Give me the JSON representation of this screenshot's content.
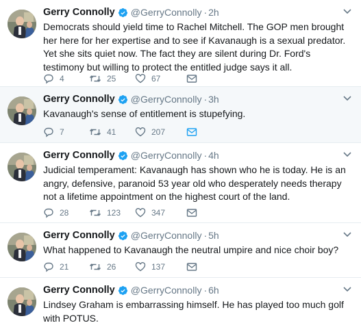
{
  "colors": {
    "accent": "#1da1f2",
    "muted": "#657786",
    "text": "#14171a",
    "border": "#e6ecf0",
    "hover_bg": "#f5f8fa"
  },
  "icons": [
    "avatar",
    "verified-badge-icon",
    "caret-down-icon",
    "reply-icon",
    "retweet-icon",
    "like-icon",
    "message-icon"
  ],
  "tweets": [
    {
      "name": "Gerry Connolly",
      "handle": "@GerryConnolly",
      "dot": "·",
      "time": "2h",
      "text": "Democrats should yield time to Rachel Mitchell. The GOP men brought her here for her expertise and to see if Kavanaugh is a sexual predator. Yet she sits quiet now. The fact they are silent during Dr. Ford's testimony but willing to protect the entitled judge says it all.",
      "replies": "4",
      "retweets": "25",
      "likes": "67"
    },
    {
      "name": "Gerry Connolly",
      "handle": "@GerryConnolly",
      "dot": "·",
      "time": "3h",
      "text": "Kavanaugh's sense of entitlement is stupefying.",
      "replies": "7",
      "retweets": "41",
      "likes": "207"
    },
    {
      "name": "Gerry Connolly",
      "handle": "@GerryConnolly",
      "dot": "·",
      "time": "4h",
      "text": "Judicial temperament: Kavanaugh has shown who he is today. He is an angry, defensive, paranoid 53 year old who desperately needs therapy not a lifetime appointment on the highest court of the land.",
      "replies": "28",
      "retweets": "123",
      "likes": "347"
    },
    {
      "name": "Gerry Connolly",
      "handle": "@GerryConnolly",
      "dot": "·",
      "time": "5h",
      "text": "What happened to Kavanaugh the neutral umpire and nice choir boy?",
      "replies": "21",
      "retweets": "26",
      "likes": "137"
    },
    {
      "name": "Gerry Connolly",
      "handle": "@GerryConnolly",
      "dot": "·",
      "time": "6h",
      "text": "Lindsey Graham is embarrassing himself. He has played too much golf with POTUS."
    }
  ]
}
